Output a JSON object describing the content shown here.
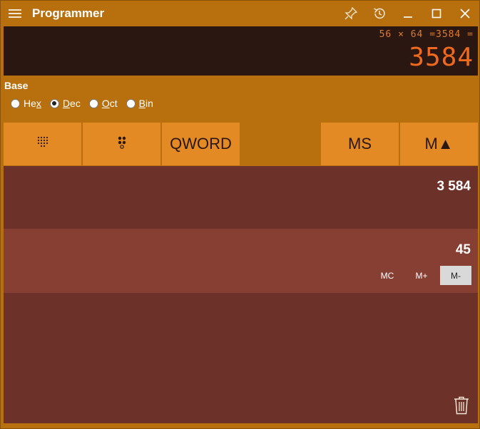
{
  "window": {
    "title": "Programmer"
  },
  "display": {
    "expression": "56 × 64 =3584 =",
    "result": "3584"
  },
  "base": {
    "label": "Base",
    "options": [
      {
        "pre": "He",
        "ul": "x",
        "post": "",
        "checked": false
      },
      {
        "pre": "",
        "ul": "D",
        "post": "ec",
        "checked": true
      },
      {
        "pre": "",
        "ul": "O",
        "post": "ct",
        "checked": false
      },
      {
        "pre": "",
        "ul": "B",
        "post": "in",
        "checked": false
      }
    ]
  },
  "toolbar": {
    "keypad_icon": "keypad-dots-icon",
    "bitflip_icon": "bit-toggle-icon",
    "word_size": "QWORD",
    "ms": "MS",
    "mem_list": "M▲"
  },
  "memory": {
    "items": [
      {
        "value": "3 584"
      },
      {
        "value": "45"
      }
    ],
    "actions": {
      "mc": "MC",
      "mplus": "M+",
      "mminus": "M-"
    }
  },
  "colors": {
    "window": "#b8700f",
    "display_bg": "#2a1712",
    "display_text": "#ef6a1e",
    "button_bg": "#e38a24",
    "memory_bg": "#6c322a",
    "memory_selected": "#873e33"
  }
}
